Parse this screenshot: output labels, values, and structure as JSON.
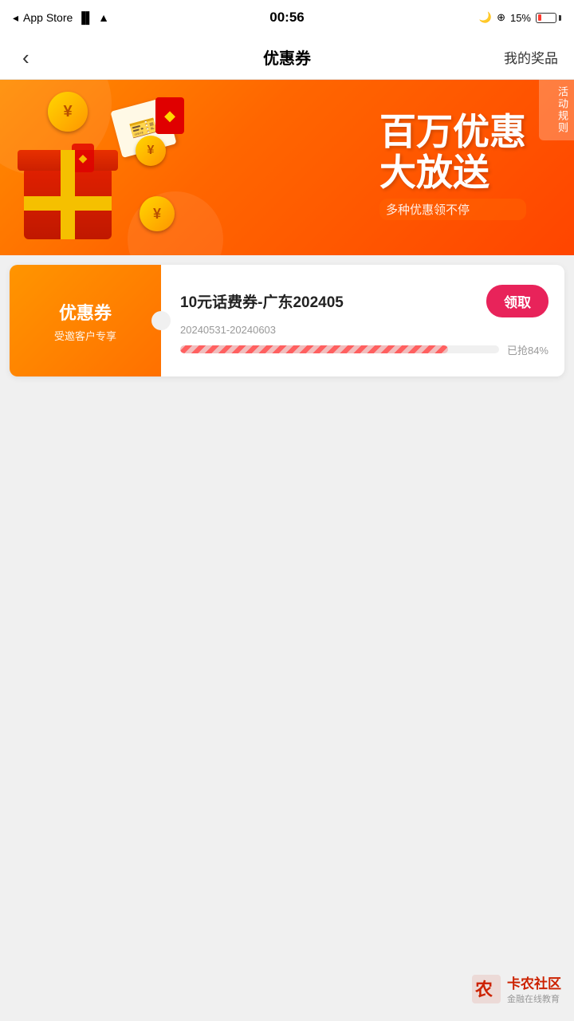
{
  "statusBar": {
    "carrier": "App Store",
    "time": "00:56",
    "battery": "15%"
  },
  "navBar": {
    "back": "‹",
    "title": "优惠券",
    "rightAction": "我的奖品"
  },
  "banner": {
    "titleLine1": "百万优惠",
    "titleLine2": "大放送",
    "subtitle": "多种优惠领不停",
    "rules": "活动规则"
  },
  "couponCard": {
    "leftTitle": "优惠券",
    "leftSubtitle": "受邀客户专享",
    "name": "10元话费券-广东202405",
    "dateRange": "20240531-20240603",
    "claimLabel": "领取",
    "progressPercent": 84,
    "progressText": "已抢84%"
  },
  "watermark": {
    "main": "卡农社区",
    "sub": "金融在线教育"
  }
}
